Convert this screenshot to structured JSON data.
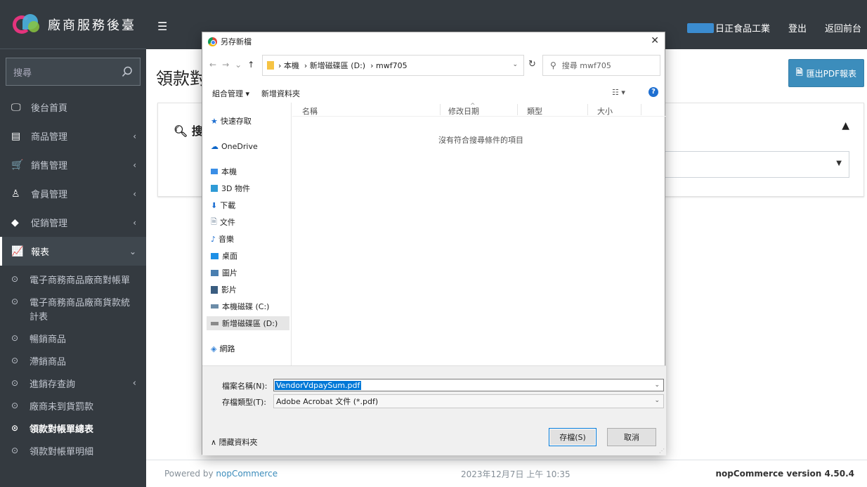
{
  "brand": {
    "title": "廠商服務後臺"
  },
  "sidebar": {
    "search_placeholder": "搜尋",
    "items": [
      {
        "label": "後台首頁",
        "icon": "monitor-icon"
      },
      {
        "label": "商品管理",
        "icon": "document-icon",
        "arrow": "‹"
      },
      {
        "label": "銷售管理",
        "icon": "cart-icon",
        "arrow": "‹"
      },
      {
        "label": "會員管理",
        "icon": "user-icon",
        "arrow": "‹"
      },
      {
        "label": "促銷管理",
        "icon": "tag-icon",
        "arrow": "‹"
      },
      {
        "label": "報表",
        "icon": "chart-icon",
        "arrow": "⌄"
      }
    ],
    "sub_items": [
      {
        "label": "電子商務商品廠商對帳單",
        "icon": "radio-icon"
      },
      {
        "label": "電子商務商品廠商貨款統計表",
        "icon": "radio-icon"
      },
      {
        "label": "暢銷商品",
        "icon": "radio-icon"
      },
      {
        "label": "滯銷商品",
        "icon": "radio-icon"
      },
      {
        "label": "進銷存查詢",
        "icon": "radio-icon",
        "arrow": "‹"
      },
      {
        "label": "廠商未到貨罰款",
        "icon": "radio-icon"
      },
      {
        "label": "領款對帳單總表",
        "icon": "radio-icon",
        "active": true
      },
      {
        "label": "領款對帳單明細",
        "icon": "radio-icon"
      }
    ]
  },
  "topbar": {
    "vendor_name": "日正食品工業",
    "logout": "登出",
    "back_to_front": "返回前台"
  },
  "main": {
    "page_title": "領款對",
    "export_button": "匯出PDF報表",
    "search_card_title": "搜"
  },
  "footer": {
    "powered_prefix": "Powered by ",
    "powered_link": "nopCommerce",
    "datetime": "2023年12月7日 上午 10:35",
    "version": "nopCommerce version 4.50.4"
  },
  "dialog": {
    "title": "另存新檔",
    "path": [
      "本機",
      "新增磁碟區 (D:)",
      "mwf705"
    ],
    "search_placeholder": "搜尋 mwf705",
    "toolbar": {
      "organize": "組合管理 ▾",
      "new_folder": "新增資料夾"
    },
    "tree": [
      {
        "label": "快速存取",
        "icon": "star-icon",
        "color": "#1e6fd1"
      },
      {
        "label": "OneDrive",
        "icon": "cloud-icon",
        "color": "#0a64c8"
      },
      {
        "label": "本機",
        "icon": "computer-icon",
        "color": "#3a8ee6"
      },
      {
        "label": "3D 物件",
        "icon": "cube-icon",
        "color": "#2f9bd6"
      },
      {
        "label": "下載",
        "icon": "download-icon",
        "color": "#1e6fd1"
      },
      {
        "label": "文件",
        "icon": "file-icon",
        "color": "#7a8ca0"
      },
      {
        "label": "音樂",
        "icon": "music-icon",
        "color": "#1e6fd1"
      },
      {
        "label": "桌面",
        "icon": "desktop-icon",
        "color": "#1e90e6"
      },
      {
        "label": "圖片",
        "icon": "image-icon",
        "color": "#4a7fb0"
      },
      {
        "label": "影片",
        "icon": "film-icon",
        "color": "#3a5d80"
      },
      {
        "label": "本機磁碟 (C:)",
        "icon": "drive-icon",
        "color": "#6c8ca8"
      },
      {
        "label": "新增磁碟區 (D:)",
        "icon": "drive-icon",
        "color": "#8a8a8a",
        "selected": true
      },
      {
        "label": "網路",
        "icon": "network-icon",
        "color": "#2f7fd6"
      }
    ],
    "columns": [
      "名稱",
      "修改日期",
      "類型",
      "大小"
    ],
    "empty_message": "沒有符合搜尋條件的項目",
    "filename_label": "檔案名稱(N):",
    "filename_value": "VendorVdpaySum.pdf",
    "filetype_label": "存檔類型(T):",
    "filetype_value": "Adobe Acrobat 文件 (*.pdf)",
    "hide_folders": "隱藏資料夾",
    "save_button": "存檔(S)",
    "cancel_button": "取消"
  }
}
